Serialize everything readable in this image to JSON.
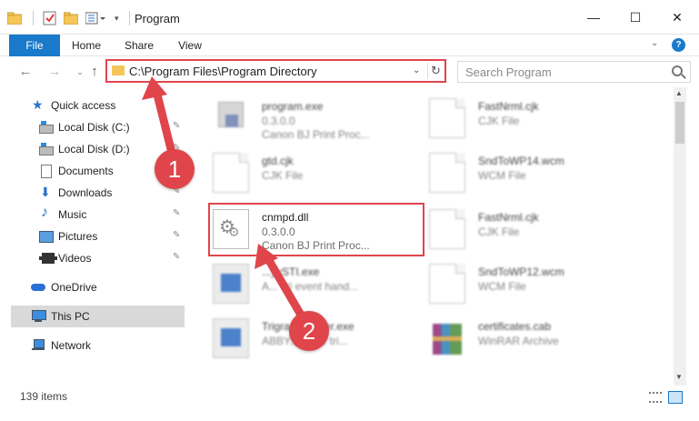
{
  "window": {
    "title": "Program",
    "minimize_glyph": "—",
    "maximize_glyph": "☐",
    "close_glyph": "✕"
  },
  "ribbon": {
    "tabs": [
      "File",
      "Home",
      "Share",
      "View"
    ],
    "collapse_glyph": "⌄",
    "help_glyph": "?"
  },
  "nav": {
    "back_glyph": "←",
    "forward_glyph": "→",
    "recent_glyph": "⌄",
    "up_glyph": "↑",
    "address": "C:\\Program Files\\Program Directory",
    "address_chevron": "⌄",
    "refresh_glyph": "↻",
    "search_placeholder": "Search Program"
  },
  "sidebar": {
    "items": [
      {
        "label": "Quick access",
        "icon": "star-icon"
      },
      {
        "label": "Local Disk (C:)",
        "icon": "disk-icon",
        "pinned": true
      },
      {
        "label": "Local Disk (D:)",
        "icon": "disk-icon",
        "pinned": true
      },
      {
        "label": "Documents",
        "icon": "documents-icon",
        "pinned": true
      },
      {
        "label": "Downloads",
        "icon": "downloads-icon",
        "pinned": true
      },
      {
        "label": "Music",
        "icon": "music-icon",
        "pinned": true
      },
      {
        "label": "Pictures",
        "icon": "pictures-icon",
        "pinned": true
      },
      {
        "label": "Videos",
        "icon": "videos-icon",
        "pinned": true
      },
      {
        "label": "OneDrive",
        "icon": "onedrive-icon"
      },
      {
        "label": "This PC",
        "icon": "pc-icon",
        "selected": true
      },
      {
        "label": "Network",
        "icon": "network-icon"
      }
    ],
    "pin_glyph": "📌"
  },
  "files": [
    {
      "name": "program.exe",
      "line1": "0.3.0.0",
      "line2": "Canon BJ Print Proc...",
      "icon": "exe-icon"
    },
    {
      "name": "FastNrml.cjk",
      "line1": "CJK File",
      "line2": "",
      "icon": "document-icon"
    },
    {
      "name": "gtd.cjk",
      "line1": "CJK File",
      "line2": "",
      "icon": "document-icon"
    },
    {
      "name": "SndToWP14.wcm",
      "line1": "WCM File",
      "line2": "",
      "icon": "document-icon"
    },
    {
      "name": "cnmpd.dll",
      "line1": "0.3.0.0",
      "line2": "Canon BJ Print Proc...",
      "icon": "gear-file-icon"
    },
    {
      "name": "FastNrml.cjk",
      "line1": "CJK File",
      "line2": "",
      "icon": "document-icon"
    },
    {
      "name": "...yySTI.exe",
      "line1": "A... sti event hand...",
      "line2": "",
      "icon": "app-icon"
    },
    {
      "name": "SndToWP12.wcm",
      "line1": "WCM File",
      "line2": "",
      "icon": "document-icon"
    },
    {
      "name": "Trigra...nstaller.exe",
      "line1": "ABBY... ...der tri...",
      "line2": "",
      "icon": "app-icon"
    },
    {
      "name": "certificates.cab",
      "line1": "WinRAR Archive",
      "line2": "",
      "icon": "winrar-icon"
    }
  ],
  "scrollbar": {
    "up_glyph": "▲",
    "down_glyph": "▼"
  },
  "status": {
    "item_count": "139 items"
  },
  "annotations": {
    "badge1": "1",
    "badge2": "2"
  },
  "colors": {
    "accent": "#1979ca",
    "annotation_red": "#e0454c",
    "selected_bg": "#d9d9d9"
  }
}
